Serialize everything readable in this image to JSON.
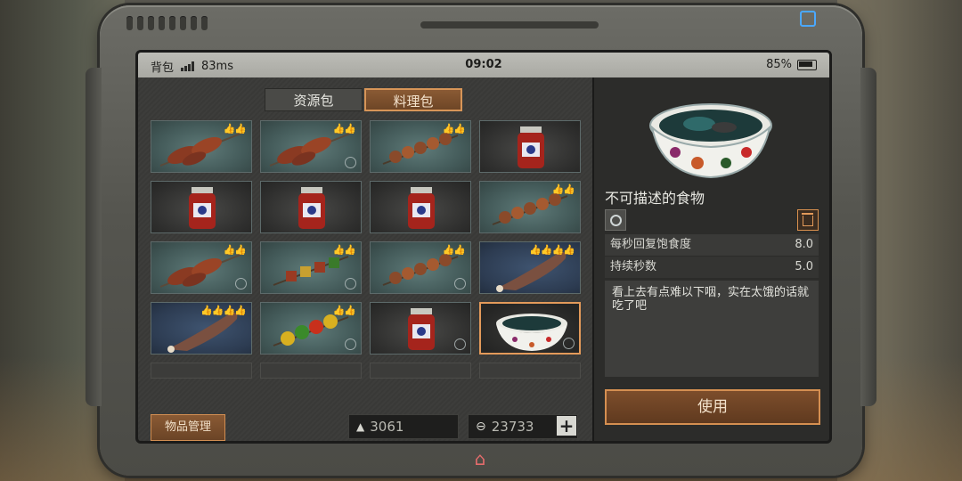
{
  "status_bar": {
    "app_label": "背包",
    "ping": "83ms",
    "time": "09:02",
    "battery": "85%"
  },
  "tabs": [
    {
      "label": "资源包",
      "active": false
    },
    {
      "label": "料理包",
      "active": true
    }
  ],
  "inventory": [
    {
      "item": "meat-skewer",
      "thumbs": "👍👍",
      "bound": false
    },
    {
      "item": "meat-skewer",
      "thumbs": "👍👍",
      "bound": true
    },
    {
      "item": "mushroom-skewer",
      "thumbs": "👍👍",
      "bound": false
    },
    {
      "item": "jam-jar",
      "thumbs": "",
      "bound": false
    },
    {
      "item": "jam-jar",
      "thumbs": "",
      "bound": false
    },
    {
      "item": "jam-jar",
      "thumbs": "",
      "bound": false
    },
    {
      "item": "jam-jar",
      "thumbs": "",
      "bound": false
    },
    {
      "item": "mushroom-skewer",
      "thumbs": "👍👍",
      "bound": false
    },
    {
      "item": "meat-skewer",
      "thumbs": "👍👍",
      "bound": true
    },
    {
      "item": "mixed-skewer",
      "thumbs": "👍👍",
      "bound": true
    },
    {
      "item": "mushroom-skewer",
      "thumbs": "👍👍",
      "bound": true
    },
    {
      "item": "roast-leg",
      "thumbs": "👍👍👍👍",
      "bound": false
    },
    {
      "item": "roast-leg",
      "thumbs": "👍👍👍👍",
      "bound": false
    },
    {
      "item": "veggie-skewer",
      "thumbs": "👍👍",
      "bound": true
    },
    {
      "item": "jam-jar",
      "thumbs": "",
      "bound": true
    },
    {
      "item": "mystery-bowl",
      "thumbs": "",
      "bound": true,
      "selected": true
    }
  ],
  "bottom_bar": {
    "manage_label": "物品管理",
    "currency_1": "3061",
    "currency_2": "23733",
    "plus_label": "+"
  },
  "detail": {
    "title": "不可描述的食物",
    "stats": [
      {
        "label": "每秒回复饱食度",
        "value": "8.0"
      },
      {
        "label": "持续秒数",
        "value": "5.0"
      }
    ],
    "description": "看上去有点难以下咽，实在太饿的话就吃了吧",
    "use_label": "使用"
  },
  "colors": {
    "accent": "#d58f51",
    "selected_border": "#e39a5a"
  }
}
